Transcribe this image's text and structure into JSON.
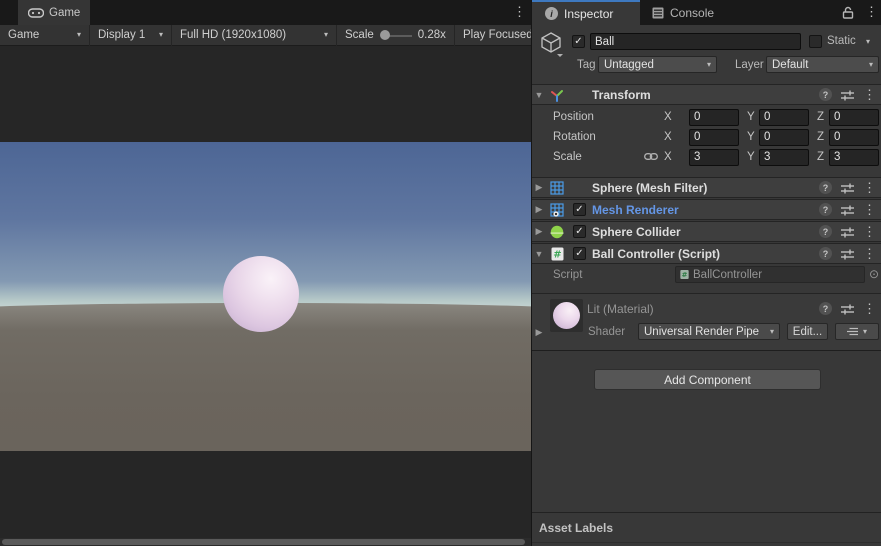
{
  "game": {
    "tab_label": "Game",
    "toolbar": {
      "mode": "Game",
      "display": "Display 1",
      "resolution": "Full HD (1920x1080)",
      "scale_label": "Scale",
      "scale_value": "0.28x",
      "play_focused": "Play Focused"
    }
  },
  "inspector": {
    "tabs": {
      "inspector": "Inspector",
      "console": "Console"
    },
    "header": {
      "name": "Ball",
      "static_label": "Static",
      "tag_label": "Tag",
      "tag_value": "Untagged",
      "layer_label": "Layer",
      "layer_value": "Default"
    },
    "transform": {
      "title": "Transform",
      "axis": {
        "x": "X",
        "y": "Y",
        "z": "Z"
      },
      "rows": [
        {
          "label": "Position",
          "x": "0",
          "y": "0",
          "z": "0"
        },
        {
          "label": "Rotation",
          "x": "0",
          "y": "0",
          "z": "0"
        },
        {
          "label": "Scale",
          "x": "3",
          "y": "3",
          "z": "3"
        }
      ]
    },
    "components": [
      {
        "title": "Sphere (Mesh Filter)"
      },
      {
        "title": "Mesh Renderer"
      },
      {
        "title": "Sphere Collider"
      },
      {
        "title": "Ball Controller (Script)"
      }
    ],
    "script_row": {
      "label": "Script",
      "value": "BallController"
    },
    "material": {
      "title": "Lit (Material)",
      "shader_label": "Shader",
      "shader_value": "Universal Render Pipe",
      "edit_button": "Edit..."
    },
    "add_component": "Add Component",
    "asset_labels": "Asset Labels"
  },
  "icons": {
    "kebab": "⋮",
    "dropdown": "▾",
    "foldout_open": "▼",
    "foldout_closed": "▶",
    "check": "✓",
    "help": "?",
    "target": "⊙",
    "info": "i"
  },
  "colors": {
    "tab_accent_blue": "#3e79c0",
    "mesh_renderer_text": "#6496e6",
    "sphere_collider_green": "#8fd34a",
    "script_hash_green": "#3aa655",
    "material_sphere_pink": "#e8d5e8",
    "sky_top": "#4d6695",
    "sky_horizon": "#d3ded9",
    "ground": "#6b655d"
  }
}
